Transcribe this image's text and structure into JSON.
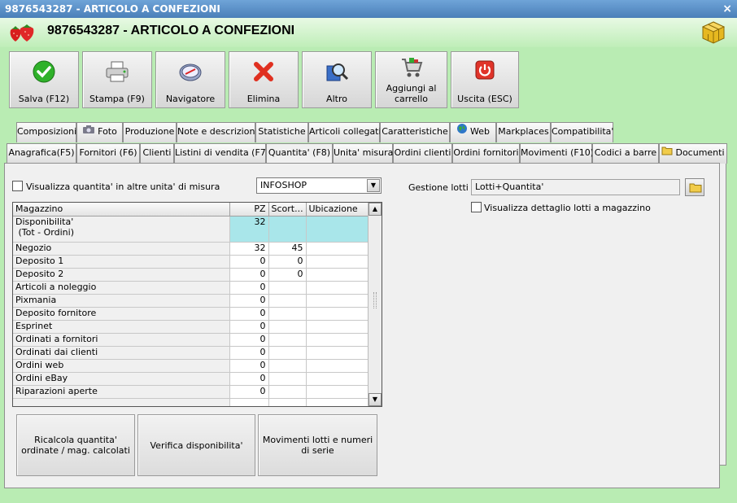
{
  "window": {
    "titlebar": "9876543287 - ARTICOLO A CONFEZIONI",
    "title": "9876543287 - ARTICOLO A CONFEZIONI",
    "close": "×"
  },
  "toolbar": [
    {
      "label": "Salva (F12)",
      "icon": "check-icon"
    },
    {
      "label": "Stampa (F9)",
      "icon": "printer-icon"
    },
    {
      "label": "Navigatore",
      "icon": "compass-icon"
    },
    {
      "label": "Elimina",
      "icon": "delete-x-icon"
    },
    {
      "label": "Altro",
      "icon": "magnifier-book-icon"
    },
    {
      "label": "Aggiungi al carrello",
      "icon": "cart-icon"
    },
    {
      "label": "Uscita (ESC)",
      "icon": "power-icon"
    }
  ],
  "tabs_top": [
    "Composizioni",
    "Foto",
    "Produzione",
    "Note e descrizioni",
    "Statistiche",
    "Articoli collegati",
    "Caratteristiche",
    "Web",
    "Markplaces",
    "Compatibilita'"
  ],
  "tabs_bottom": [
    "Anagrafica(F5)",
    "Fornitori (F6)",
    "Clienti",
    "Listini di vendita (F7)",
    "Quantita' (F8)",
    "Unita' misura",
    "Ordini clienti",
    "Ordini fornitori",
    "Movimenti (F10)",
    "Codici a barre",
    "Documenti"
  ],
  "active_tab": "Quantita' (F8)",
  "quantita": {
    "show_other_units_label": "Visualizza quantita' in altre unita' di misura",
    "show_other_units_checked": false,
    "store_select": "INFOSHOP",
    "scroll_down": "▼",
    "scroll_up": "▲",
    "columns": [
      "Magazzino",
      "PZ",
      "Scort...",
      "Ubicazione"
    ],
    "rows": [
      {
        "name": "Disponibilita'",
        "sub": "(Tot - Ordini)",
        "pz": "32",
        "scorta": "",
        "ubicazione": ""
      },
      {
        "name": "Negozio",
        "pz": "32",
        "scorta": "45",
        "ubicazione": ""
      },
      {
        "name": "Deposito 1",
        "pz": "0",
        "scorta": "0",
        "ubicazione": ""
      },
      {
        "name": "Deposito 2",
        "pz": "0",
        "scorta": "0",
        "ubicazione": ""
      },
      {
        "name": "Articoli a noleggio",
        "pz": "0",
        "scorta": "",
        "ubicazione": ""
      },
      {
        "name": "Pixmania",
        "pz": "0",
        "scorta": "",
        "ubicazione": ""
      },
      {
        "name": "Deposito fornitore",
        "pz": "0",
        "scorta": "",
        "ubicazione": ""
      },
      {
        "name": "Esprinet",
        "pz": "0",
        "scorta": "",
        "ubicazione": ""
      },
      {
        "name": "Ordinati a fornitori",
        "pz": "0",
        "scorta": "",
        "ubicazione": ""
      },
      {
        "name": "Ordinati dai clienti",
        "pz": "0",
        "scorta": "",
        "ubicazione": ""
      },
      {
        "name": "Ordini web",
        "pz": "0",
        "scorta": "",
        "ubicazione": ""
      },
      {
        "name": "Ordini eBay",
        "pz": "0",
        "scorta": "",
        "ubicazione": ""
      },
      {
        "name": "Riparazioni aperte",
        "pz": "0",
        "scorta": "",
        "ubicazione": ""
      }
    ],
    "buttons": [
      "Ricalcola quantita' ordinate / mag. calcolati",
      "Verifica disponibilita'",
      "Movimenti lotti e numeri di serie"
    ],
    "lotti_label": "Gestione lotti :",
    "lotti_value": "Lotti+Quantita'",
    "lotti_detail_label": "Visualizza dettaglio lotti a magazzino",
    "lotti_detail_checked": false
  },
  "colors": {
    "background": "#b9ecb3",
    "titlebar": "#5a8fc8",
    "highlight_cell": "#a9e6ea"
  }
}
